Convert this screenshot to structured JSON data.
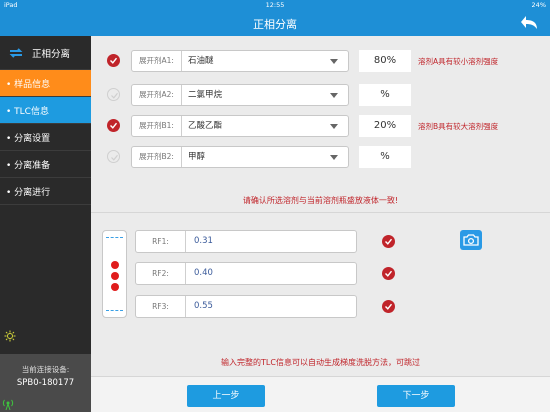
{
  "status": {
    "device": "iPad",
    "time": "12:55",
    "battery": "24%"
  },
  "header": {
    "title": "正相分离"
  },
  "sidebar": {
    "header_label": "正相分离",
    "items": [
      {
        "label": "• 样品信息"
      },
      {
        "label": "• TLC信息"
      },
      {
        "label": "• 分离设置"
      },
      {
        "label": "• 分离准备"
      },
      {
        "label": "• 分离进行"
      }
    ],
    "footer_label": "当前连接设备:",
    "device_name": "SPB0-180177"
  },
  "solvents": [
    {
      "label": "展开剂A1:",
      "value": "石油醚",
      "percent": "80%",
      "checked": true,
      "note": "溶剂A具有较小溶剂强度"
    },
    {
      "label": "展开剂A2:",
      "value": "二氯甲烷",
      "percent": "%",
      "checked": false,
      "note": ""
    },
    {
      "label": "展开剂B1:",
      "value": "乙酸乙酯",
      "percent": "20%",
      "checked": true,
      "note": "溶剂B具有较大溶剂强度"
    },
    {
      "label": "展开剂B2:",
      "value": "甲醇",
      "percent": "%",
      "checked": false,
      "note": ""
    }
  ],
  "warning": "请确认所选溶剂与当前溶剂瓶盛放液体一致!",
  "rf": [
    {
      "label": "RF1:",
      "value": "0.31"
    },
    {
      "label": "RF2:",
      "value": "0.40"
    },
    {
      "label": "RF3:",
      "value": "0.55"
    }
  ],
  "hint": "输入完整的TLC信息可以自动生成梯度洗脱方法，可跳过",
  "buttons": {
    "prev": "上一步",
    "next": "下一步"
  },
  "colors": {
    "accent": "#1e8fd6",
    "active": "#ff8c1a",
    "alert": "#c0242a",
    "spot": "#e01c1c"
  },
  "icons": {
    "back": "back-arrow-icon",
    "swap": "swap-arrows-icon",
    "camera": "camera-icon",
    "check": "checkmark-icon",
    "sun": "sun-icon",
    "tower": "signal-tower-icon"
  }
}
